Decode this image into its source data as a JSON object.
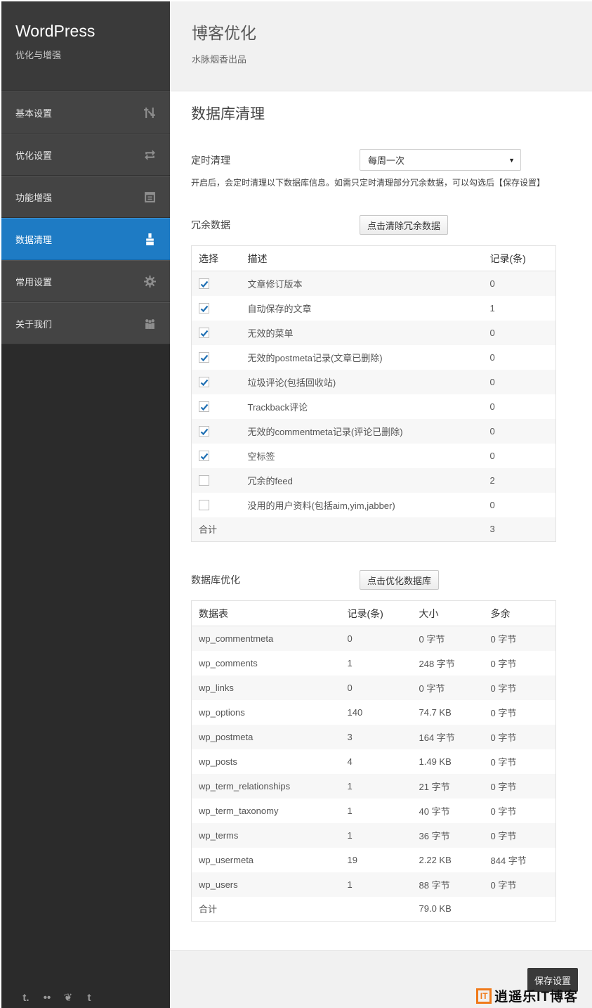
{
  "sidebar": {
    "brand_title": "WordPress",
    "brand_subtitle": "优化与增强",
    "items": [
      {
        "label": "基本设置",
        "icon": "tools-icon"
      },
      {
        "label": "优化设置",
        "icon": "repeat-icon"
      },
      {
        "label": "功能增强",
        "icon": "archive-icon"
      },
      {
        "label": "数据清理",
        "icon": "broom-icon"
      },
      {
        "label": "常用设置",
        "icon": "gear-icon"
      },
      {
        "label": "关于我们",
        "icon": "people-icon"
      }
    ],
    "active_index": 3,
    "social": [
      {
        "icon": "tumblr-icon",
        "glyph": "t."
      },
      {
        "icon": "flickr-icon",
        "glyph": "••"
      },
      {
        "icon": "leaf-icon",
        "glyph": "❦"
      },
      {
        "icon": "twitter-icon",
        "glyph": "t"
      }
    ]
  },
  "header": {
    "title": "博客优化",
    "subtitle": "水脉烟香出品"
  },
  "main": {
    "section_title": "数据库清理",
    "schedule": {
      "label": "定时清理",
      "selected": "每周一次",
      "hint": "开启后，会定时清理以下数据库信息。如需只定时清理部分冗余数据，可以勾选后【保存设置】"
    },
    "redundant": {
      "label": "冗余数据",
      "button": "点击清除冗余数据",
      "columns": [
        "选择",
        "描述",
        "记录(条)"
      ],
      "rows": [
        {
          "checked": true,
          "desc": "文章修订版本",
          "count": "0"
        },
        {
          "checked": true,
          "desc": "自动保存的文章",
          "count": "1"
        },
        {
          "checked": true,
          "desc": "无效的菜单",
          "count": "0"
        },
        {
          "checked": true,
          "desc": "无效的postmeta记录(文章已删除)",
          "count": "0"
        },
        {
          "checked": true,
          "desc": "垃圾评论(包括回收站)",
          "count": "0"
        },
        {
          "checked": true,
          "desc": "Trackback评论",
          "count": "0"
        },
        {
          "checked": true,
          "desc": "无效的commentmeta记录(评论已删除)",
          "count": "0"
        },
        {
          "checked": true,
          "desc": "空标签",
          "count": "0"
        },
        {
          "checked": false,
          "desc": "冗余的feed",
          "count": "2"
        },
        {
          "checked": false,
          "desc": "没用的用户资料(包括aim,yim,jabber)",
          "count": "0"
        }
      ],
      "total_label": "合计",
      "total_count": "3"
    },
    "optimize": {
      "label": "数据库优化",
      "button": "点击优化数据库",
      "columns": [
        "数据表",
        "记录(条)",
        "大小",
        "多余"
      ],
      "rows": [
        {
          "table": "wp_commentmeta",
          "records": "0",
          "size": "0 字节",
          "overhead": "0 字节"
        },
        {
          "table": "wp_comments",
          "records": "1",
          "size": "248 字节",
          "overhead": "0 字节"
        },
        {
          "table": "wp_links",
          "records": "0",
          "size": "0 字节",
          "overhead": "0 字节"
        },
        {
          "table": "wp_options",
          "records": "140",
          "size": "74.7 KB",
          "overhead": "0 字节"
        },
        {
          "table": "wp_postmeta",
          "records": "3",
          "size": "164 字节",
          "overhead": "0 字节"
        },
        {
          "table": "wp_posts",
          "records": "4",
          "size": "1.49 KB",
          "overhead": "0 字节"
        },
        {
          "table": "wp_term_relationships",
          "records": "1",
          "size": "21 字节",
          "overhead": "0 字节"
        },
        {
          "table": "wp_term_taxonomy",
          "records": "1",
          "size": "40 字节",
          "overhead": "0 字节"
        },
        {
          "table": "wp_terms",
          "records": "1",
          "size": "36 字节",
          "overhead": "0 字节"
        },
        {
          "table": "wp_usermeta",
          "records": "19",
          "size": "2.22 KB",
          "overhead": "844 字节"
        },
        {
          "table": "wp_users",
          "records": "1",
          "size": "88 字节",
          "overhead": "0 字节"
        }
      ],
      "total_label": "合计",
      "total_size": "79.0 KB"
    }
  },
  "footer": {
    "save_button": "保存设置",
    "watermark_logo": "IT",
    "watermark_text": "逍遥乐IT博客"
  },
  "colors": {
    "sidebar_bg": "#2b2b2b",
    "nav_item_bg": "#444444",
    "active_bg": "#1e7bc4",
    "check_color": "#1e6fb3",
    "watermark_accent": "#f07a1a"
  }
}
